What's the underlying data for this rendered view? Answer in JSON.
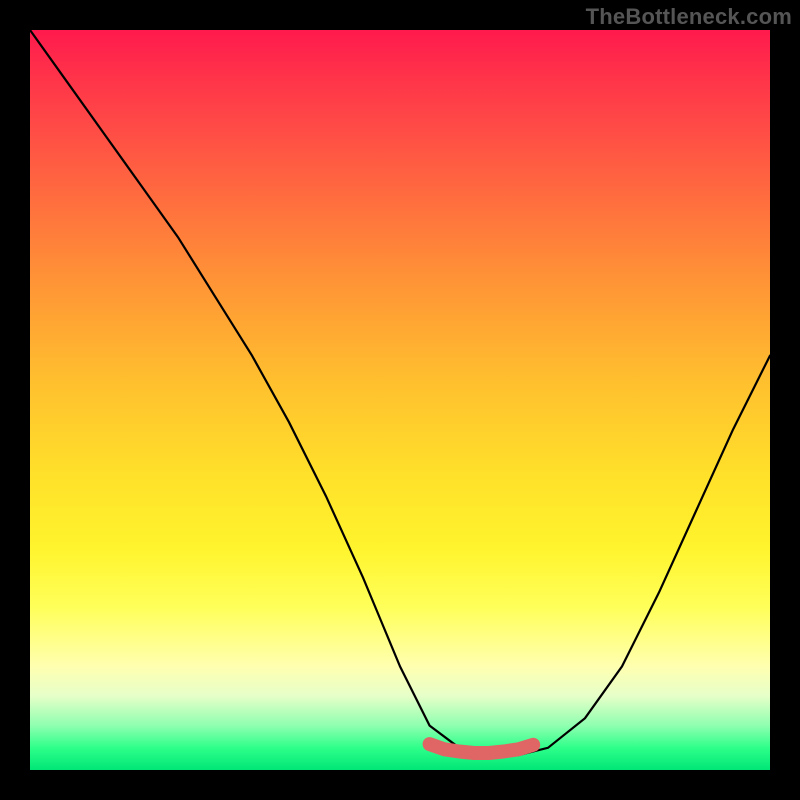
{
  "watermark": "TheBottleneck.com",
  "chart_data": {
    "type": "line",
    "title": "",
    "xlabel": "",
    "ylabel": "",
    "xlim": [
      0,
      100
    ],
    "ylim": [
      0,
      100
    ],
    "series": [
      {
        "name": "curve",
        "x": [
          0,
          5,
          10,
          15,
          20,
          25,
          30,
          35,
          40,
          45,
          50,
          54,
          58,
          62,
          66,
          70,
          75,
          80,
          85,
          90,
          95,
          100
        ],
        "y": [
          100,
          93,
          86,
          79,
          72,
          64,
          56,
          47,
          37,
          26,
          14,
          6,
          3,
          2,
          2,
          3,
          7,
          14,
          24,
          35,
          46,
          56
        ]
      }
    ],
    "highlight": {
      "name": "bottom-band",
      "color": "#e06666",
      "x": [
        54,
        56,
        58,
        60,
        62,
        64,
        66,
        68
      ],
      "y": [
        3.5,
        2.8,
        2.5,
        2.3,
        2.3,
        2.5,
        2.8,
        3.4
      ]
    },
    "colors": {
      "curve": "#000000",
      "highlight": "#e06666",
      "frame": "#000000"
    }
  }
}
